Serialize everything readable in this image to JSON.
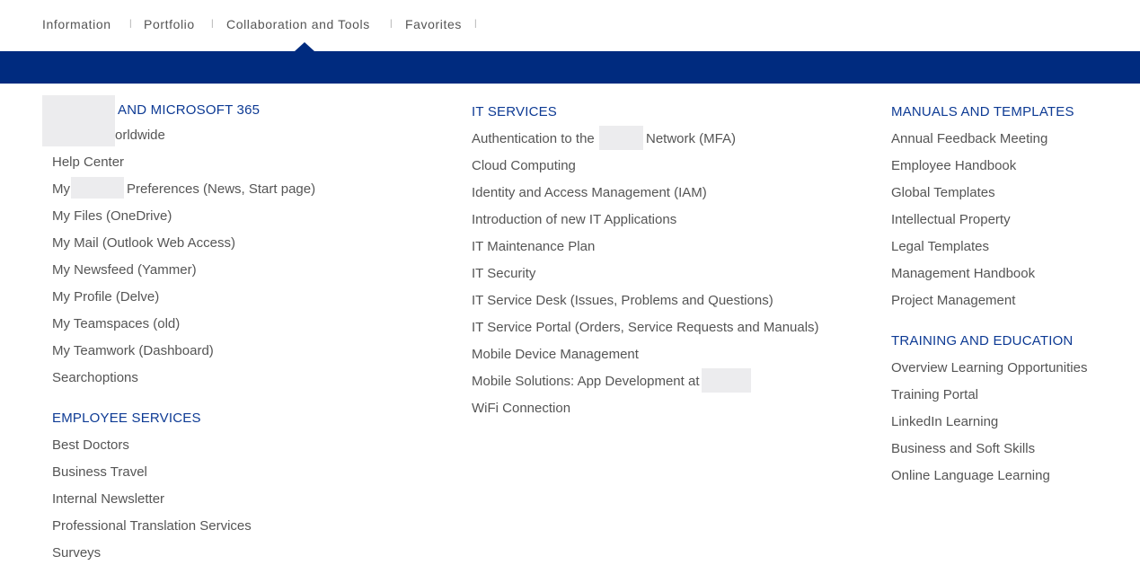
{
  "topnav": {
    "items": [
      "Information",
      "Portfolio",
      "Collaboration and Tools",
      "Favorites"
    ],
    "active": "Collaboration and Tools",
    "separator": "|"
  },
  "columns": {
    "left": {
      "heading1": "AND MICROSOFT 365",
      "links1": [
        "orldwide",
        "Help Center",
        "My",
        "Preferences (News, Start page)",
        "My Files (OneDrive)",
        "My Mail (Outlook Web Access)",
        "My Newsfeed (Yammer)",
        "My Profile (Delve)",
        "My Teamspaces (old)",
        "My Teamwork (Dashboard)",
        "Searchoptions"
      ],
      "heading2": "EMPLOYEE SERVICES",
      "links2": [
        "Best Doctors",
        "Business Travel",
        "Internal Newsletter",
        "Professional Translation Services",
        "Surveys"
      ]
    },
    "middle": {
      "heading": "IT SERVICES",
      "links": [
        "Authentication to the",
        "Network (MFA)",
        "Cloud Computing",
        "Identity and Access Management (IAM)",
        "Introduction of new IT Applications",
        "IT Maintenance Plan",
        "IT Security",
        "IT Service Desk (Issues, Problems and Questions)",
        "IT Service Portal (Orders, Service Requests and Manuals)",
        "Mobile Device Management",
        "Mobile Solutions: App Development at",
        "WiFi Connection"
      ]
    },
    "right": {
      "heading1": "MANUALS AND TEMPLATES",
      "links1": [
        "Annual Feedback Meeting",
        "Employee Handbook",
        "Global Templates",
        "Intellectual Property",
        "Legal Templates",
        "Management Handbook",
        "Project Management"
      ],
      "heading2": "TRAINING AND EDUCATION",
      "links2": [
        "Overview Learning Opportunities",
        "Training Portal",
        "LinkedIn Learning",
        "Business and Soft Skills",
        "Online Language Learning"
      ]
    }
  },
  "colors": {
    "accent_bar": "#002b7f",
    "heading": "#0d3a94",
    "link_text": "#555555"
  }
}
